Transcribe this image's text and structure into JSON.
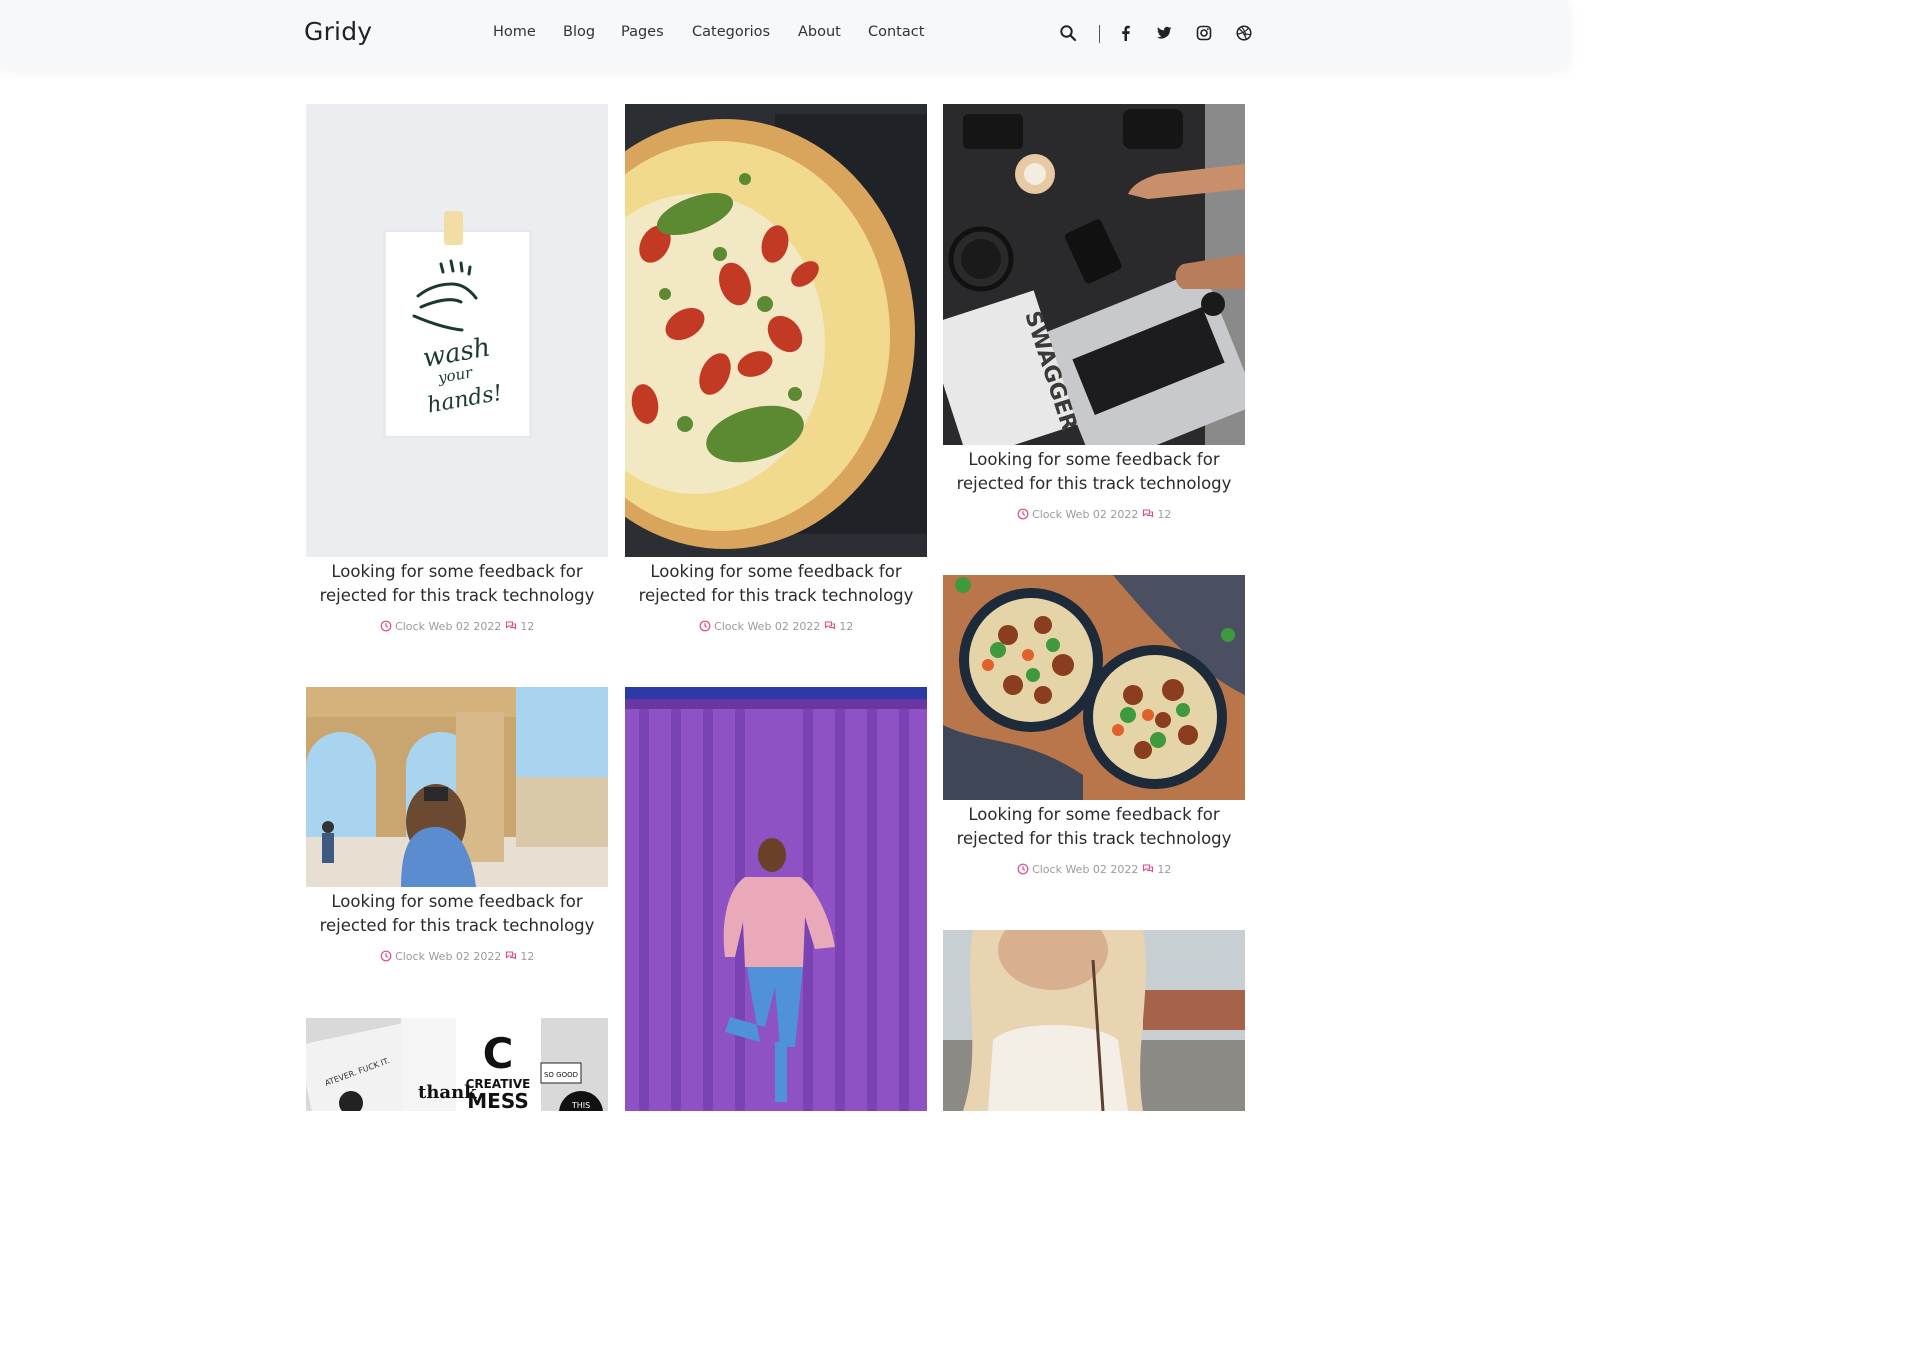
{
  "header": {
    "logo": "Gridy",
    "nav": [
      {
        "label": "Home"
      },
      {
        "label": "Blog"
      },
      {
        "label": "Pages"
      },
      {
        "label": "Categorios"
      },
      {
        "label": "About"
      },
      {
        "label": "Contact"
      }
    ],
    "icons": [
      "search-icon",
      "facebook-icon",
      "twitter-icon",
      "instagram-icon",
      "dribbble-icon"
    ]
  },
  "colors": {
    "accent": "#e4468c",
    "meta_text": "#9a9a9a",
    "header_bg": "#f7f8fa"
  },
  "posts": [
    {
      "title": "Looking for some feedback for rejected for this track technology",
      "date": "Clock Web 02 2022",
      "comments": "12",
      "image": "wash-your-hands-card"
    },
    {
      "title": "Looking for some feedback for rejected for this track technology",
      "date": "Clock Web 02 2022",
      "comments": "12",
      "image": "pizza"
    },
    {
      "title": "Looking for some feedback for rejected for this track technology",
      "date": "Clock Web 02 2022",
      "comments": "12",
      "image": "desk-laptop-magazine"
    },
    {
      "title": "Looking for some feedback for rejected for this track technology",
      "date": "Clock Web 02 2022",
      "comments": "12",
      "image": "traveler-photographing-arches"
    },
    {
      "title": "",
      "date": "",
      "comments": "",
      "image": "woman-purple-wall"
    },
    {
      "title": "Looking for some feedback for rejected for this track technology",
      "date": "Clock Web 02 2022",
      "comments": "12",
      "image": "noodle-bowls"
    },
    {
      "title": "",
      "date": "",
      "comments": "",
      "image": "creative-mess-papers"
    },
    {
      "title": "",
      "date": "",
      "comments": "",
      "image": "blonde-woman-portrait"
    }
  ],
  "image_text": {
    "wash": [
      "wash",
      "your",
      "hands!"
    ],
    "swagger": "SWAGGER",
    "creative": [
      "C",
      "CREATIVE",
      "MESS",
      "thank",
      "SO GOOD",
      "THIS",
      "ATEVER. FUCK IT."
    ]
  }
}
